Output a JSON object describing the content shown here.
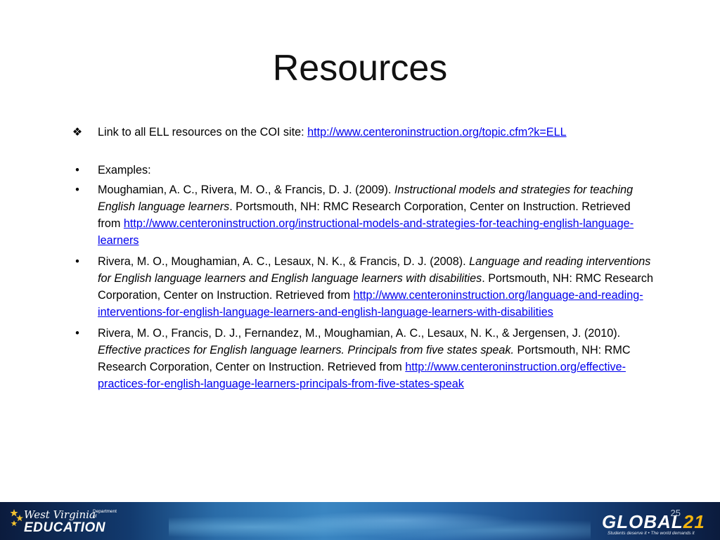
{
  "slide": {
    "title": "Resources",
    "page_number": "25"
  },
  "icons": {
    "first_bullet": "diamond-bullet-icon",
    "bullet": "round-bullet-icon"
  },
  "first_item": {
    "text": "Link to all ELL resources on the COI site:  ",
    "link": "http://www.centeroninstruction.org/topic.cfm?k=ELL"
  },
  "examples_label": "Examples:",
  "references": [
    {
      "authors": "Moughamian, A. C., Rivera, M. O., & Francis, D. J. (2009). ",
      "title": "Instructional models and strategies for teaching English language learners",
      "publisher": ".  Portsmouth, NH:  RMC Research Corporation, Center on Instruction.  Retrieved from ",
      "link": "http://www.centeroninstruction.org/instructional-models-and-strategies-for-teaching-english-language-learners"
    },
    {
      "authors": "Rivera, M. O., Moughamian, A. C., Lesaux, N. K., & Francis, D. J.  (2008).  ",
      "title": "Language and reading interventions for English language learners and English language learners with disabilities",
      "publisher": ".  Portsmouth, NH:  RMC Research Corporation, Center on Instruction.  Retrieved from ",
      "link": "http://www.centeroninstruction.org/language-and-reading-interventions-for-english-language-learners-and-english-language-learners-with-disabilities"
    },
    {
      "authors": "Rivera, M. O., Francis, D. J., Fernandez, M., Moughamian, A. C., Lesaux, N. K., & Jergensen, J. (2010).  ",
      "title": "Effective practices for English language learners.  Principals from five states speak.",
      "publisher": "  Portsmouth, NH:  RMC Research Corporation, Center on Instruction.  Retrieved from ",
      "link": "http://www.centeroninstruction.org/effective-practices-for-english-language-learners-principals-from-five-states-speak"
    }
  ],
  "footer": {
    "wv_logo": {
      "top": "West Virginia",
      "dept": "Department of",
      "main": "EDUCATION"
    },
    "global21": {
      "prefix": "GLOBAL",
      "suffix": "21",
      "tagline": "Students deserve it • The world demands it"
    }
  },
  "colors": {
    "link": "#0000ee",
    "footer_dark": "#0b1b3d",
    "footer_light": "#3a86c2",
    "global21_accent": "#f2b40f"
  }
}
